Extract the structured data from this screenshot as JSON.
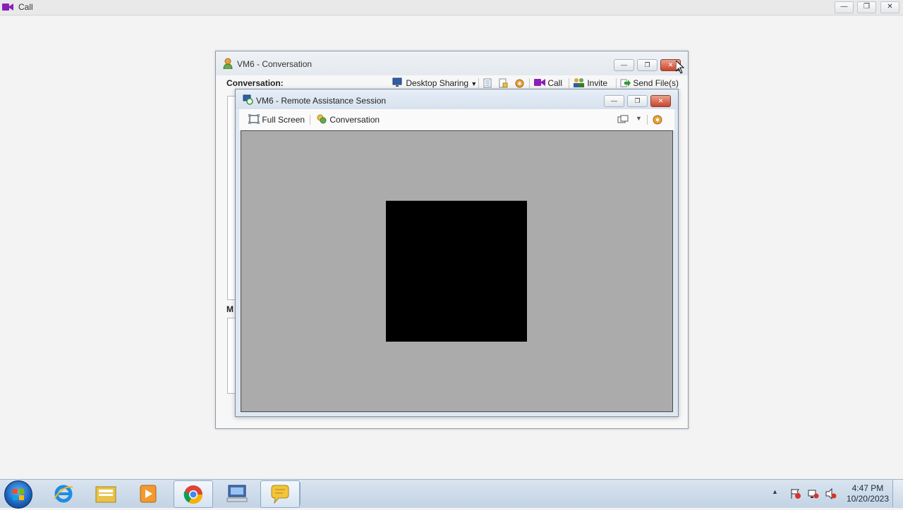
{
  "app_bar": {
    "title": "Call",
    "icon": "video-camera-icon",
    "buttons": [
      {
        "name": "minimize",
        "glyph": "—"
      },
      {
        "name": "restore",
        "glyph": "❐"
      },
      {
        "name": "close",
        "glyph": "✕"
      }
    ]
  },
  "conversation_window": {
    "title": "VM6 - Conversation",
    "icon": "contact-icon",
    "label": "Conversation:",
    "message_label_partial": "M",
    "toolbar": {
      "desktop_sharing": "Desktop Sharing",
      "call": "Call",
      "invite": "Invite",
      "send_files": "Send File(s)"
    }
  },
  "remote_window": {
    "title": "VM6 - Remote Assistance Session",
    "toolbar": {
      "full_screen": "Full Screen",
      "conversation": "Conversation"
    }
  },
  "taskbar": {
    "items": [
      "start-orb",
      "internet-explorer-icon",
      "file-explorer-icon",
      "media-player-icon",
      "chrome-icon",
      "remote-desktop-icon",
      "chat-bubble-icon"
    ],
    "active_item": "chat-bubble-icon",
    "clock": {
      "time": "4:47 PM",
      "date": "10/20/2023"
    }
  },
  "colors": {
    "accent": "#c9452b",
    "call_icon": "#8a1fb8",
    "viewport_bg": "#ababab",
    "taskbar_top": "#d9e4f0"
  }
}
